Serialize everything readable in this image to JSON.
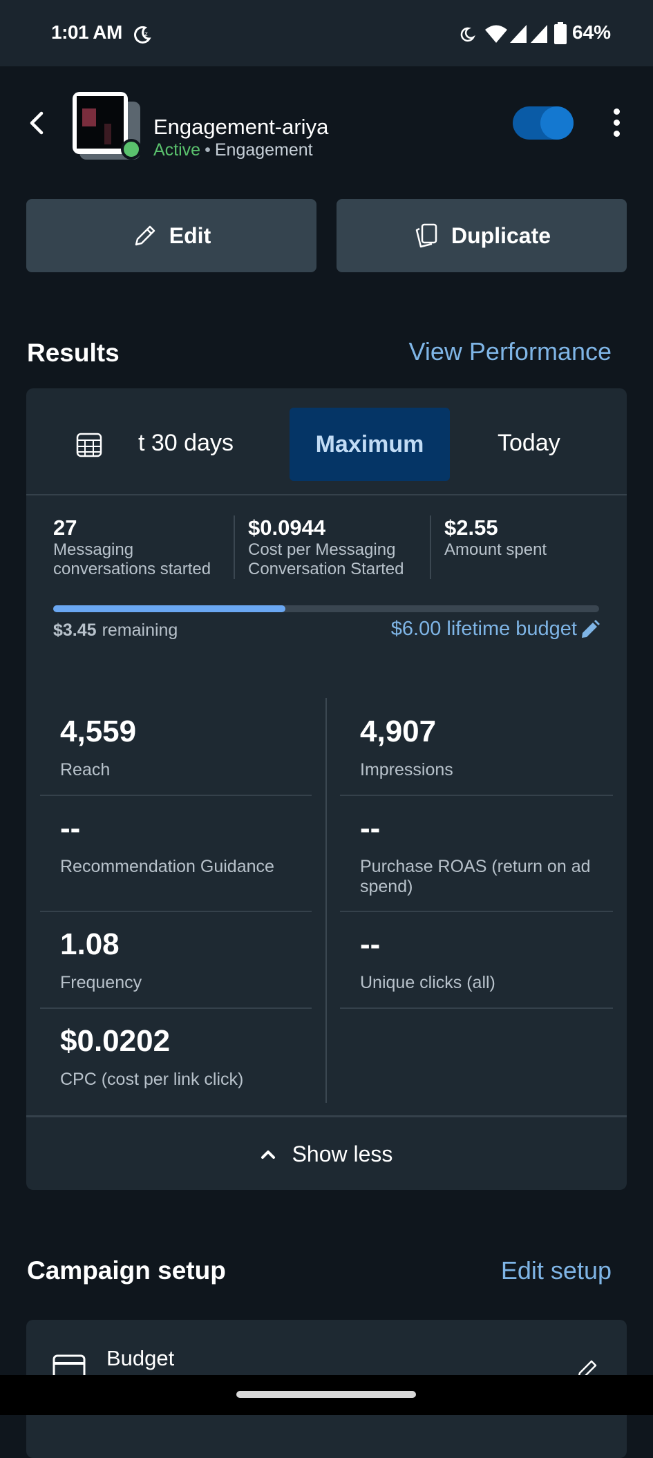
{
  "status_bar": {
    "time": "1:01 AM",
    "battery": "64%"
  },
  "header": {
    "title": "Engagement-ariya",
    "status": "Active",
    "separator": "•",
    "objective": "Engagement",
    "toggle_on": true
  },
  "actions": {
    "edit_label": "Edit",
    "duplicate_label": "Duplicate"
  },
  "results": {
    "title": "Results",
    "link": "View Performance",
    "date_tabs": [
      "t 30 days",
      "Maximum",
      "Today"
    ],
    "selected_tab": "Maximum",
    "summary": [
      {
        "value": "27",
        "label": "Messaging conversations started"
      },
      {
        "value": "$0.0944",
        "label": "Cost per Messaging Conversation Started"
      },
      {
        "value": "$2.55",
        "label": "Amount spent"
      }
    ],
    "budget": {
      "remaining_amount": "$3.45",
      "remaining_label": "remaining",
      "lifetime_label": "$6.00 lifetime budget",
      "spent_fraction": 0.425
    },
    "metrics_left": [
      {
        "value": "4,559",
        "label": "Reach"
      },
      {
        "value": "--",
        "label": "Recommendation Guidance"
      },
      {
        "value": "1.08",
        "label": "Frequency"
      },
      {
        "value": "$0.0202",
        "label": "CPC (cost per link click)"
      }
    ],
    "metrics_right": [
      {
        "value": "4,907",
        "label": "Impressions"
      },
      {
        "value": "--",
        "label": "Purchase ROAS (return on ad spend)"
      },
      {
        "value": "--",
        "label": "Unique clicks (all)"
      }
    ],
    "show_less": "Show less"
  },
  "campaign_setup": {
    "title": "Campaign setup",
    "link": "Edit setup",
    "first_item": "Budget"
  },
  "colors": {
    "background": "#0f161d",
    "card": "#1e2932",
    "accent_link": "#7fb5e6",
    "active_green": "#5ac16d",
    "selected_tab": "#053566"
  }
}
